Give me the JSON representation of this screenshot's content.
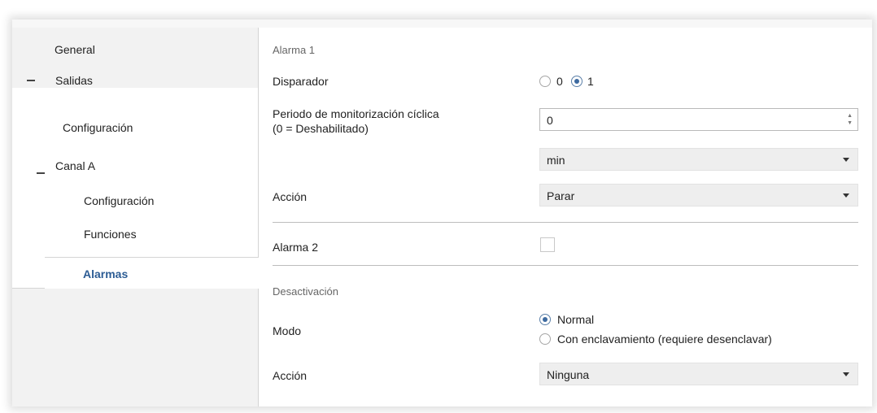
{
  "sidebar": {
    "general": "General",
    "salidas": "Salidas",
    "configuracion": "Configuración",
    "canal_a": "Canal A",
    "canal_configuracion": "Configuración",
    "funciones": "Funciones",
    "alarmas": "Alarmas"
  },
  "main": {
    "alarma1_header": "Alarma 1",
    "disparador_label": "Disparador",
    "disparador_options": [
      "0",
      "1"
    ],
    "disparador_selected": "1",
    "periodo_label_line1": "Periodo de monitorización cíclica",
    "periodo_label_line2": "(0 = Deshabilitado)",
    "periodo_value": "0",
    "unit_select": "min",
    "accion_label": "Acción",
    "accion_select": "Parar",
    "alarma2_label": "Alarma 2",
    "alarma2_checked": false,
    "desactivacion_header": "Desactivación",
    "modo_label": "Modo",
    "modo_options": [
      "Normal",
      "Con enclavamiento (requiere desenclavar)"
    ],
    "modo_selected": "Normal",
    "accion2_label": "Acción",
    "accion2_select": "Ninguna"
  }
}
